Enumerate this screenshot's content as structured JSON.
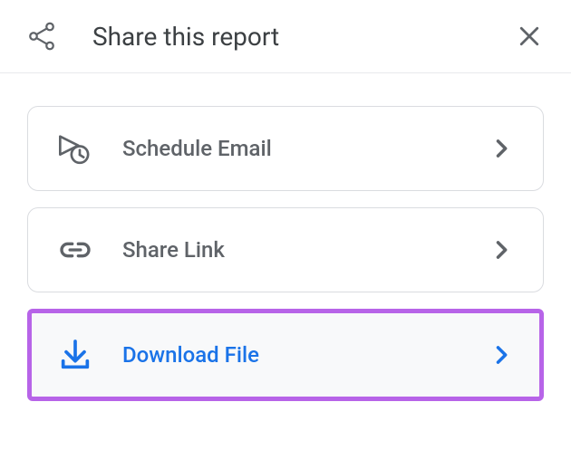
{
  "header": {
    "title": "Share this report"
  },
  "options": [
    {
      "label": "Schedule Email",
      "highlighted": false
    },
    {
      "label": "Share Link",
      "highlighted": false
    },
    {
      "label": "Download File",
      "highlighted": true
    }
  ]
}
